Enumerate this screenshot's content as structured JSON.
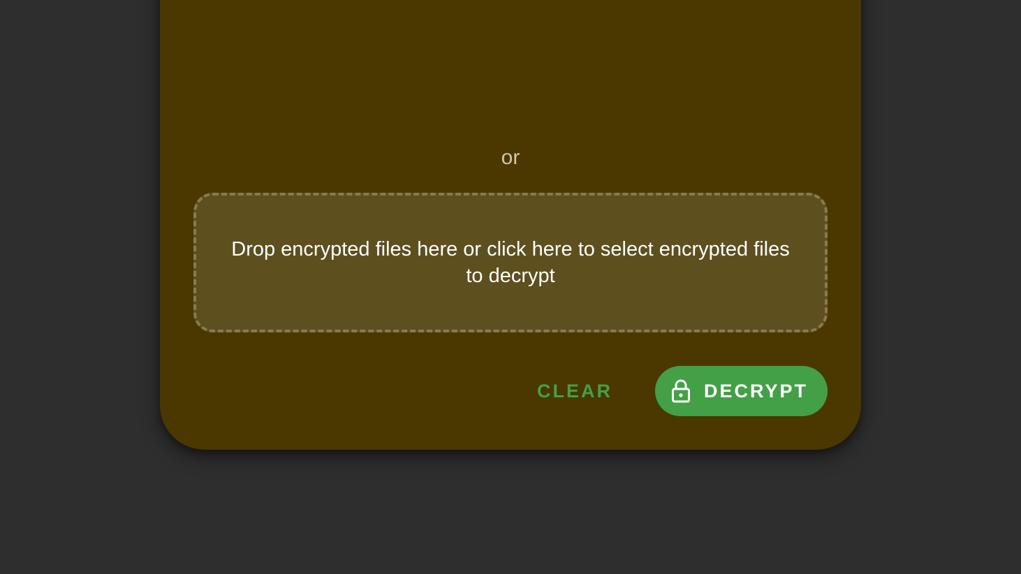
{
  "divider": {
    "or_text": "or"
  },
  "dropzone": {
    "text": "Drop encrypted files here or click here to select encrypted files to decrypt"
  },
  "actions": {
    "clear_label": "CLEAR",
    "decrypt_label": "DECRYPT",
    "decrypt_icon": "lock-icon"
  },
  "colors": {
    "background": "#2e2e2e",
    "card": "#4a3800",
    "dropzone": "#5e4f1f",
    "accent": "#43a047"
  }
}
